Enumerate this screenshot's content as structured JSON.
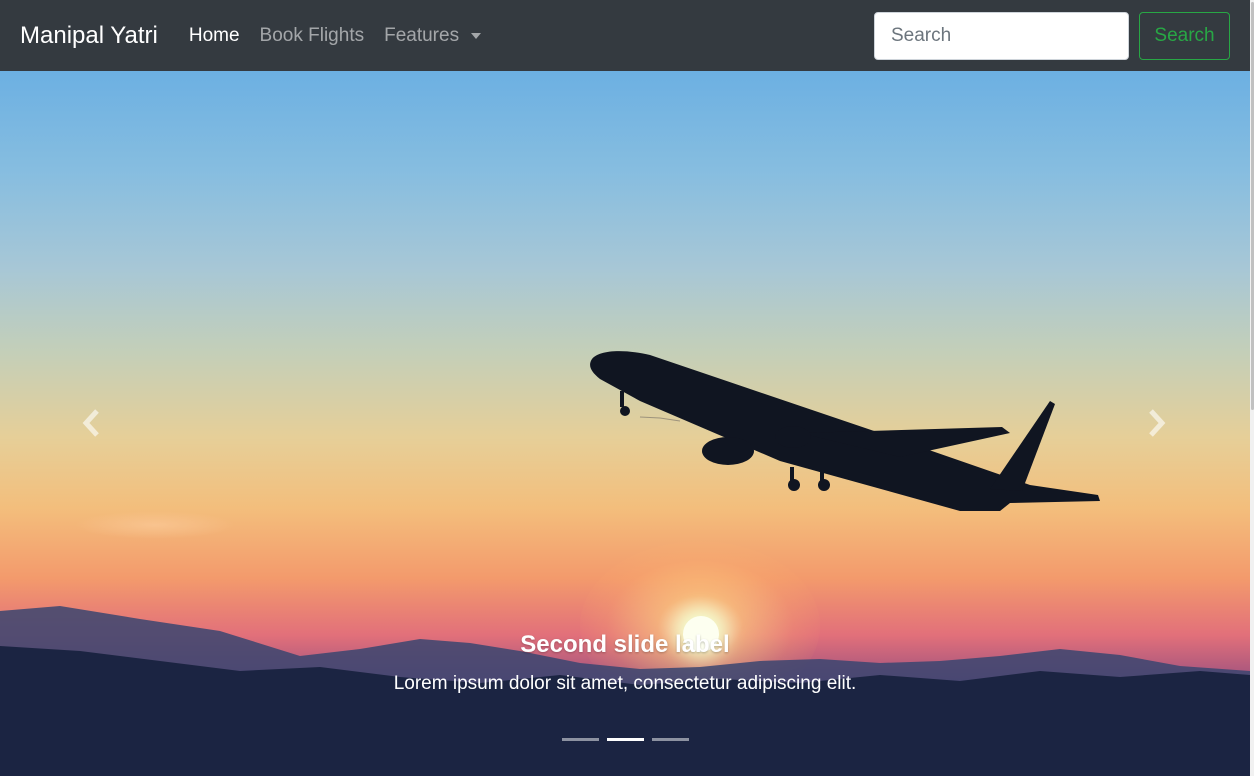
{
  "navbar": {
    "brand": "Manipal Yatri",
    "links": [
      {
        "label": "Home",
        "active": true
      },
      {
        "label": "Book Flights",
        "active": false
      },
      {
        "label": "Features",
        "active": false,
        "dropdown": true
      }
    ],
    "search": {
      "placeholder": "Search",
      "button_label": "Search"
    }
  },
  "carousel": {
    "active_slide": 2,
    "slide_count": 3,
    "caption": {
      "title": "Second slide label",
      "text": "Lorem ipsum dolor sit amet, consectetur adipiscing elit."
    },
    "prev_icon": "chevron-left-icon",
    "next_icon": "chevron-right-icon"
  },
  "colors": {
    "navbar_bg": "#343a40",
    "success": "#28a745",
    "nav_inactive": "rgba(255,255,255,0.55)"
  }
}
